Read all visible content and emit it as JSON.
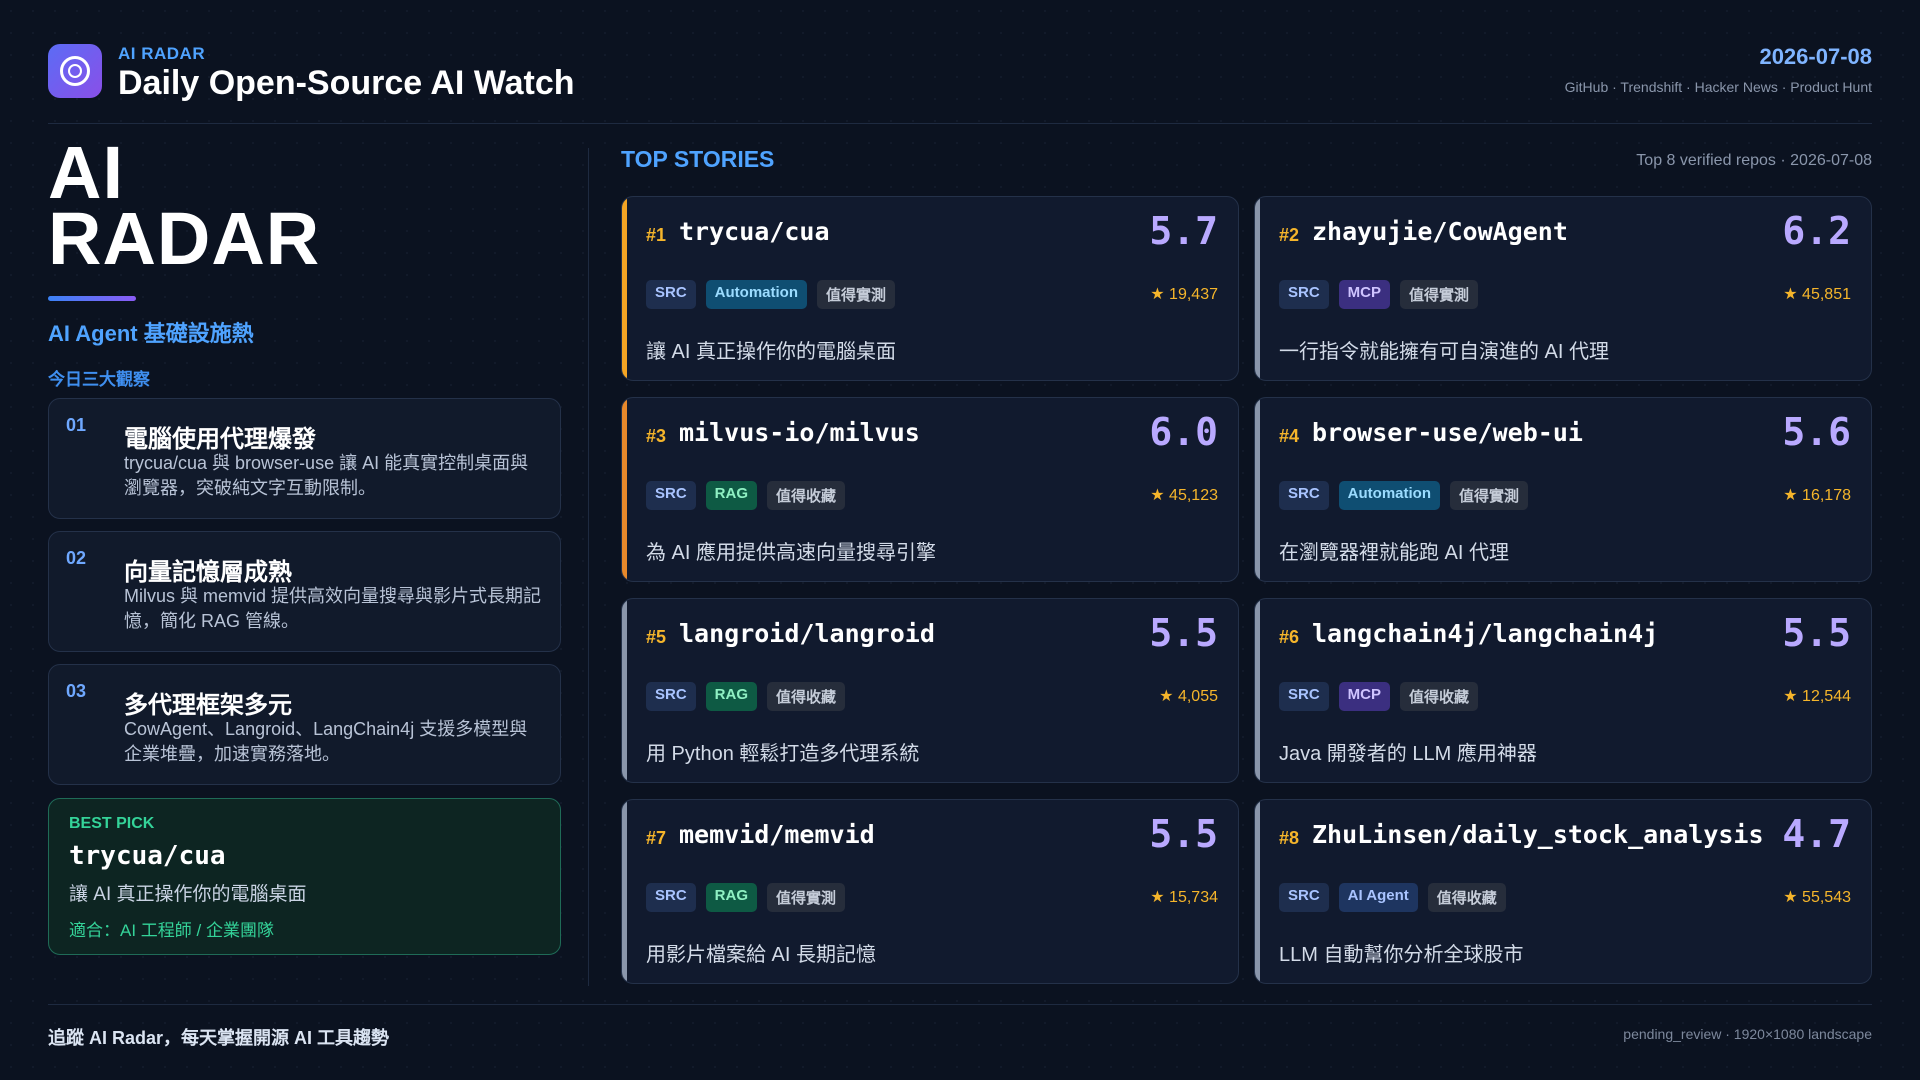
{
  "header": {
    "brand_small": "AI RADAR",
    "title": "Daily Open-Source AI Watch",
    "date": "2026-07-08",
    "sources": "GitHub · Trendshift · Hacker News · Product Hunt"
  },
  "left": {
    "big_title_line1": "AI",
    "big_title_line2": "RADAR",
    "subtitle": "AI Agent 基礎設施熱",
    "observations_label": "今日三大觀察",
    "insights": [
      {
        "num": "01",
        "title": "電腦使用代理爆發",
        "desc": "trycua/cua 與 browser-use 讓 AI 能真實控制桌面與瀏覽器，突破純文字互動限制。"
      },
      {
        "num": "02",
        "title": "向量記憶層成熟",
        "desc": "Milvus 與 memvid 提供高效向量搜尋與影片式長期記憶，簡化 RAG 管線。"
      },
      {
        "num": "03",
        "title": "多代理框架多元",
        "desc": "CowAgent、Langroid、LangChain4j 支援多模型與企業堆疊，加速實務落地。"
      }
    ],
    "best_pick": {
      "label": "BEST PICK",
      "repo": "trycua/cua",
      "desc": "讓 AI 真正操作你的電腦桌面",
      "fit": "適合：AI 工程師 / 企業團隊"
    }
  },
  "right": {
    "section_title": "TOP STORIES",
    "meta": "Top 8 verified repos · 2026-07-08",
    "cards": [
      {
        "rank": "#1",
        "repo": "trycua/cua",
        "score": "5.7",
        "tags": [
          "SRC",
          "Automation",
          "值得實測"
        ],
        "stars": "★ 19,437",
        "desc": "讓 AI 真正操作你的電腦桌面"
      },
      {
        "rank": "#2",
        "repo": "zhayujie/CowAgent",
        "score": "6.2",
        "tags": [
          "SRC",
          "MCP",
          "值得實測"
        ],
        "stars": "★ 45,851",
        "desc": "一行指令就能擁有可自演進的 AI 代理"
      },
      {
        "rank": "#3",
        "repo": "milvus-io/milvus",
        "score": "6.0",
        "tags": [
          "SRC",
          "RAG",
          "值得收藏"
        ],
        "stars": "★ 45,123",
        "desc": "為 AI 應用提供高速向量搜尋引擎"
      },
      {
        "rank": "#4",
        "repo": "browser-use/web-ui",
        "score": "5.6",
        "tags": [
          "SRC",
          "Automation",
          "值得實測"
        ],
        "stars": "★ 16,178",
        "desc": "在瀏覽器裡就能跑 AI 代理"
      },
      {
        "rank": "#5",
        "repo": "langroid/langroid",
        "score": "5.5",
        "tags": [
          "SRC",
          "RAG",
          "值得收藏"
        ],
        "stars": "★ 4,055",
        "desc": "用 Python 輕鬆打造多代理系統"
      },
      {
        "rank": "#6",
        "repo": "langchain4j/langchain4j",
        "score": "5.5",
        "tags": [
          "SRC",
          "MCP",
          "值得收藏"
        ],
        "stars": "★ 12,544",
        "desc": "Java 開發者的 LLM 應用神器"
      },
      {
        "rank": "#7",
        "repo": "memvid/memvid",
        "score": "5.5",
        "tags": [
          "SRC",
          "RAG",
          "值得實測"
        ],
        "stars": "★ 15,734",
        "desc": "用影片檔案給 AI 長期記憶"
      },
      {
        "rank": "#8",
        "repo": "ZhuLinsen/daily_stock_analysis",
        "score": "4.7",
        "tags": [
          "SRC",
          "AI Agent",
          "值得收藏"
        ],
        "stars": "★ 55,543",
        "desc": "LLM 自動幫你分析全球股市"
      }
    ]
  },
  "footer": {
    "left": "追蹤 AI Radar，每天掌握開源 AI 工具趨勢",
    "right": "pending_review · 1920×1080 landscape"
  },
  "colors": {
    "background": "#0b1220",
    "brand_blue": "#4fa3ff",
    "score_purple": "#b9a9ff",
    "rank_gold": "#f5b52b",
    "best_pick_green": "#34d399"
  }
}
